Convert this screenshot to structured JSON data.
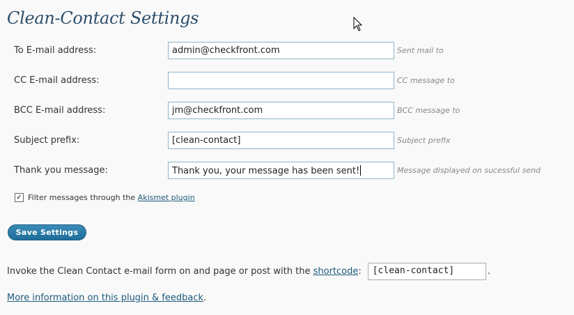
{
  "page": {
    "title": "Clean-Contact Settings"
  },
  "fields": [
    {
      "label": "To E-mail address:",
      "value": "admin@checkfront.com",
      "hint": "Sent mail to"
    },
    {
      "label": "CC E-mail address:",
      "value": "",
      "hint": "CC message to"
    },
    {
      "label": "BCC E-mail address:",
      "value": "jm@checkfront.com",
      "hint": "BCC message to"
    },
    {
      "label": "Subject prefix:",
      "value": "[clean-contact]",
      "hint": "Subject prefix"
    },
    {
      "label": "Thank you message:",
      "value": "Thank you, your message has been sent!",
      "hint": "Message displayed on sucessful send"
    }
  ],
  "filter": {
    "checked": true,
    "text": "Filter messages through the",
    "link": "Akismet plugin"
  },
  "save_button": "Save Settings",
  "invoke": {
    "text": "Invoke the Clean Contact e-mail form on and page or post with the",
    "link": "shortcode",
    "colon": ":",
    "shortcode": "[clean-contact]",
    "period": "."
  },
  "more": {
    "link": "More information on this plugin & feedback",
    "period": "."
  },
  "colors": {
    "title": "#2e4e6b",
    "button": "#21759b",
    "input_border": "#8fb5c9",
    "link": "#1b5a7a"
  }
}
